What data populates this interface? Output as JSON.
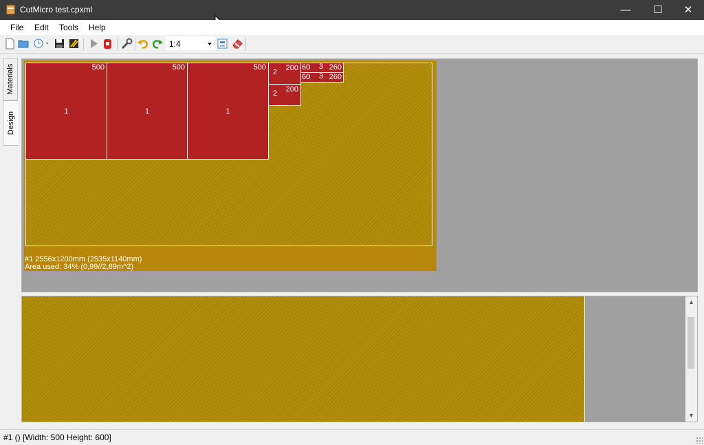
{
  "window": {
    "title": "CutMicro test.cpxml",
    "minimize_glyph": "—",
    "maximize_glyph": "☐",
    "close_glyph": "✕"
  },
  "menu": {
    "file": "File",
    "edit": "Edit",
    "tools": "Tools",
    "help": "Help"
  },
  "toolbar": {
    "icons": [
      "new-file-icon",
      "open-folder-icon",
      "recent-files-icon",
      "save-icon",
      "save-all-icon",
      "run-icon",
      "stop-icon",
      "settings-wrench-icon",
      "undo-icon",
      "redo-icon",
      "fit-view-icon",
      "eraser-icon"
    ],
    "zoom": "1:4"
  },
  "side_tabs": {
    "materials": "Materials",
    "design": "Design"
  },
  "sheet": {
    "info_line1": "#1 2556x1200mm (2535x1140mm)",
    "info_line2": "Area used: 34% (0,99//2,89m^2)",
    "parts": [
      {
        "id": "1",
        "width": "500",
        "height": "600"
      },
      {
        "id": "1",
        "width": "500",
        "height": "600"
      },
      {
        "id": "1",
        "width": "500",
        "height": "600"
      },
      {
        "id": "2",
        "width": "200",
        "height": "130"
      },
      {
        "id": "2",
        "width": "200",
        "height": "130"
      },
      {
        "id": "3",
        "width": "260",
        "height": "60"
      },
      {
        "id": "3",
        "width": "260",
        "height": "60"
      }
    ]
  },
  "status": {
    "text": "#1 () [Width: 500 Height: 600]"
  },
  "colors": {
    "part": "#b22222",
    "sheet": "#b8860b",
    "background": "#a0a0a0"
  }
}
